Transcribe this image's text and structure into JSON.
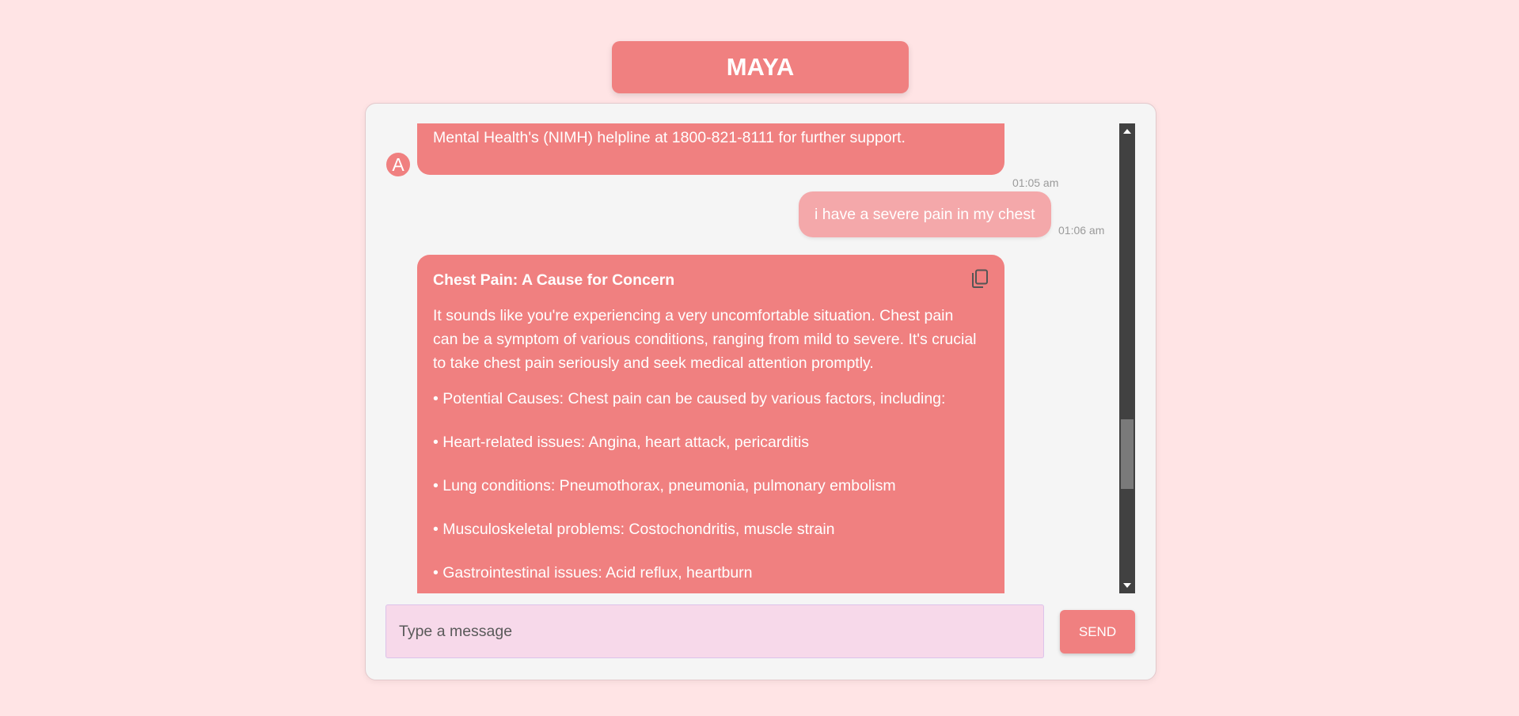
{
  "app": {
    "title": "MAYA"
  },
  "messages": [
    {
      "sender": "bot",
      "avatar_letter": "A",
      "text": "Mental Health's (NIMH) helpline at 1800-821-8111 for further support.",
      "time": "01:05 am"
    },
    {
      "sender": "user",
      "text": "i have a severe pain in my chest",
      "time": "01:06 am"
    },
    {
      "sender": "bot",
      "heading": "Chest Pain: A Cause for Concern",
      "paragraph": "It sounds like you're experiencing a very uncomfortable situation. Chest pain can be a symptom of various conditions, ranging from mild to severe. It's crucial to take chest pain seriously and seek medical attention promptly.",
      "bullets": [
        "• Potential Causes: Chest pain can be caused by various factors, including:",
        "• Heart-related issues: Angina, heart attack, pericarditis",
        "• Lung conditions: Pneumothorax, pneumonia, pulmonary embolism",
        "• Musculoskeletal problems: Costochondritis, muscle strain",
        "• Gastrointestinal issues: Acid reflux, heartburn"
      ],
      "copy_icon": "copy-icon"
    }
  ],
  "input": {
    "placeholder": "Type a message",
    "value": ""
  },
  "send_button": {
    "label": "SEND"
  },
  "colors": {
    "page_background": "#ffe4e5",
    "accent": "#f08080",
    "user_bubble": "#f4a8aa",
    "chat_background": "#f5f5f5",
    "input_background": "#f7d9ea"
  }
}
